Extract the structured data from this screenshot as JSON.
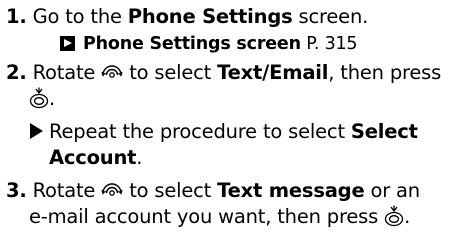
{
  "steps": [
    {
      "number": "1.",
      "pre": "Go to the ",
      "bold": "Phone Settings",
      "post": " screen.",
      "xref": {
        "label": "Phone Settings screen",
        "page_prefix": " P. ",
        "page": "315"
      }
    },
    {
      "number": "2.",
      "line1_pre": " to select ",
      "line1_bold": "Text/Email",
      "line1_post": ", then press",
      "line2_post": ".",
      "substep_pre": "Repeat the procedure to select ",
      "substep_bold1": "Select",
      "substep_bold2": "Account",
      "substep_post": "."
    },
    {
      "number": "3.",
      "line1_pre": " to select ",
      "line1_bold": "Text message",
      "line1_post": " or an",
      "line2_pre": "e-mail account you want, then press ",
      "line2_post": "."
    }
  ],
  "words": {
    "rotate": "Rotate "
  },
  "icons": {
    "rotate": "interface-dial-rotate-icon",
    "press": "interface-dial-press-icon",
    "xref": "cross-reference-arrow-icon",
    "substep": "substep-triangle-icon"
  }
}
